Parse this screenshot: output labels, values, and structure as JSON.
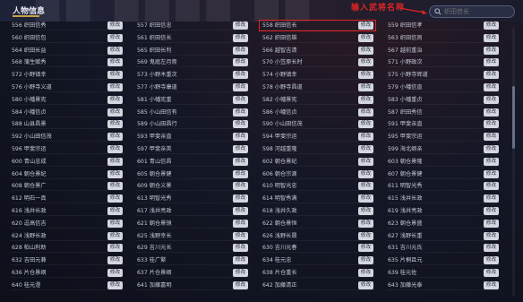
{
  "panel": {
    "title": "人物信息"
  },
  "annotation": {
    "text": "输入武将名称",
    "color": "#e02424"
  },
  "search": {
    "placeholder": "织田信长"
  },
  "button_label": "修改",
  "columns": [
    [
      "556 织田信秀",
      "560 织田信包",
      "564 织田长益",
      "568 蒲生赋秀",
      "572 小野镇幸",
      "576 小野寺义道",
      "580 小幡景宪",
      "584 小幡信贞",
      "588 山县昌景",
      "592 小山田信茂",
      "596 甲斐宗运",
      "600 青山忠成",
      "604 朝仓景纪",
      "608 朝仓景广",
      "612 明石一真",
      "616 浅井长政",
      "620 逗高信吉",
      "624 浅野长政",
      "628 柏山利助",
      "632 吉田元兼",
      "636 片仓景纲",
      "640 桂元澄"
    ],
    [
      "557 织田信忠",
      "561 织田信长",
      "565 织田长利",
      "569 鬼庭左月斋",
      "573 小野木重次",
      "577 小野寺康道",
      "581 小幡宪重",
      "585 小山田信有",
      "589 小山田昌行",
      "593 甲斐亲直",
      "597 甲斐亲英",
      "601 青山信昌",
      "605 朝仓景健",
      "609 朝仓义景",
      "613 明智光秀",
      "617 浅井亮政",
      "621 朝仓景镜",
      "625 浅野幸长",
      "629 吉川元长",
      "633 桂广繁",
      "637 片仓景纲",
      "641 加藤嘉明"
    ],
    [
      "558 织田信长",
      "562 织田信雄",
      "566 越智吉清",
      "570 小笠原长时",
      "574 小野镇幸",
      "578 小野寺昌道",
      "582 小幡景宪",
      "586 小幡信贞",
      "590 小山田信茂",
      "594 甲斐宗运",
      "598 河越重隆",
      "602 朝仓景纪",
      "606 朝仓宗滴",
      "610 明智光忠",
      "614 明智秀满",
      "618 浅井久政",
      "622 朝仓景恒",
      "626 浅野长晟",
      "630 吉川元春",
      "634 桂元忠",
      "638 片仓重长",
      "642 加藤清正"
    ],
    [
      "559 织田信孝",
      "563 织田信则",
      "567 越前重治",
      "571 小野政次",
      "575 小野寺辉道",
      "579 小幡信直",
      "583 小幡重贞",
      "587 织田秀信",
      "591 甲斐亲直",
      "595 甲斐宗运",
      "599 海北纲亲",
      "603 朝仓景隆",
      "607 朝仓景健",
      "611 明智光秀",
      "615 浅井长政",
      "619 浅井亮政",
      "623 朝仓景盛",
      "627 浅野长重",
      "631 吉川元氏",
      "635 片桐且元",
      "639 桂元佐",
      "643 加藤光泰"
    ]
  ]
}
